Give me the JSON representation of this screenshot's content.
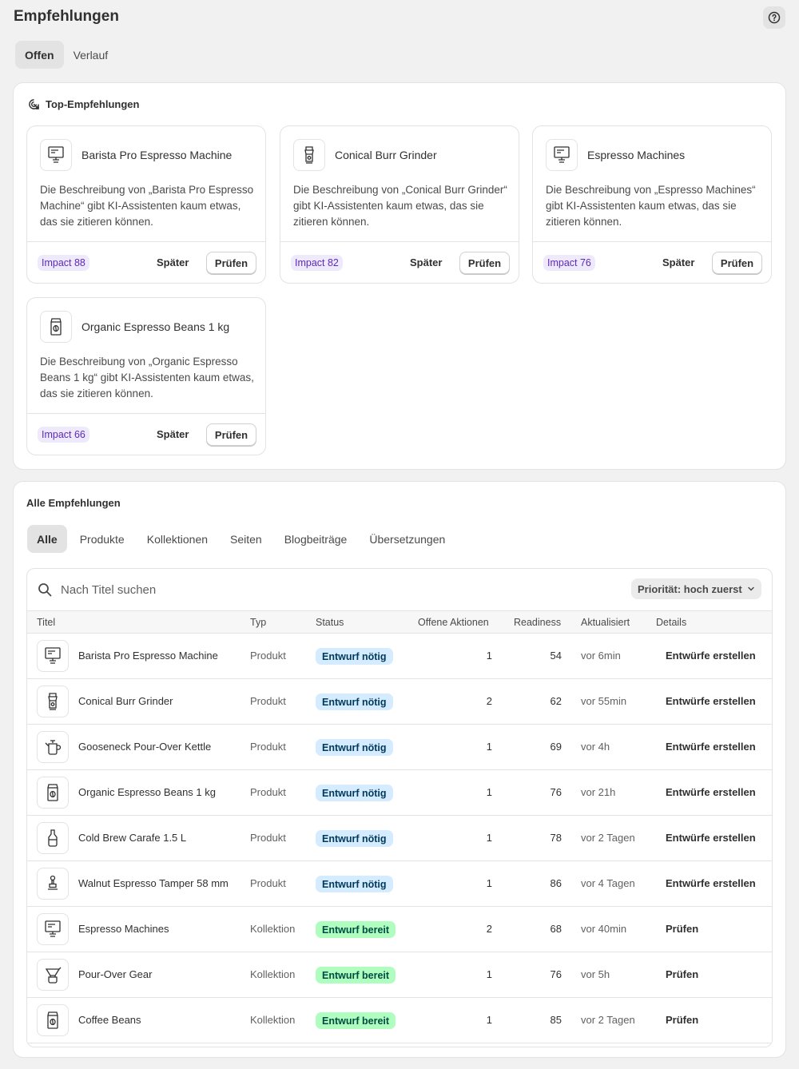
{
  "page": {
    "title": "Empfehlungen"
  },
  "top_tabs": [
    {
      "label": "Offen",
      "active": true
    },
    {
      "label": "Verlauf",
      "active": false
    }
  ],
  "top_section": {
    "title": "Top-Empfehlungen",
    "later_label": "Später",
    "review_label": "Prüfen",
    "cards": [
      {
        "name": "Barista Pro Espresso Machine",
        "icon": "espresso-machine-icon",
        "description": "Die Beschreibung von „Barista Pro Espresso Machine“ gibt KI-Assistenten kaum etwas, das sie zitieren können.",
        "impact": "Impact 88"
      },
      {
        "name": "Conical Burr Grinder",
        "icon": "grinder-icon",
        "description": "Die Beschreibung von „Conical Burr Grinder“ gibt KI-Assistenten kaum etwas, das sie zitieren können.",
        "impact": "Impact 82"
      },
      {
        "name": "Espresso Machines",
        "icon": "espresso-machine-icon",
        "description": "Die Beschreibung von „Espresso Machines“ gibt KI-Assistenten kaum etwas, das sie zitieren können.",
        "impact": "Impact 76"
      },
      {
        "name": "Organic Espresso Beans 1 kg",
        "icon": "coffee-bag-icon",
        "description": "Die Beschreibung von „Organic Espresso Beans 1 kg“ gibt KI-Assistenten kaum etwas, das sie zitieren können.",
        "impact": "Impact 66"
      }
    ]
  },
  "all_section": {
    "title": "Alle Empfehlungen",
    "filter_tabs": [
      {
        "label": "Alle",
        "active": true
      },
      {
        "label": "Produkte",
        "active": false
      },
      {
        "label": "Kollektionen",
        "active": false
      },
      {
        "label": "Seiten",
        "active": false
      },
      {
        "label": "Blogbeiträge",
        "active": false
      },
      {
        "label": "Übersetzungen",
        "active": false
      }
    ],
    "search": {
      "placeholder": "Nach Titel suchen",
      "value": ""
    },
    "sort_label": "Priorität: hoch zuerst",
    "columns": [
      "Titel",
      "Typ",
      "Status",
      "Offene Aktionen",
      "Readiness",
      "Aktualisiert",
      "Details"
    ],
    "rows": [
      {
        "title": "Barista Pro Espresso Machine",
        "icon": "espresso-machine-icon",
        "type": "Produkt",
        "status": "Entwurf nötig",
        "status_kind": "need",
        "open_actions": "1",
        "readiness": "54",
        "updated": "vor 6min",
        "action": "Entwürfe erstellen"
      },
      {
        "title": "Conical Burr Grinder",
        "icon": "grinder-icon",
        "type": "Produkt",
        "status": "Entwurf nötig",
        "status_kind": "need",
        "open_actions": "2",
        "readiness": "62",
        "updated": "vor 55min",
        "action": "Entwürfe erstellen"
      },
      {
        "title": "Gooseneck Pour-Over Kettle",
        "icon": "kettle-icon",
        "type": "Produkt",
        "status": "Entwurf nötig",
        "status_kind": "need",
        "open_actions": "1",
        "readiness": "69",
        "updated": "vor 4h",
        "action": "Entwürfe erstellen"
      },
      {
        "title": "Organic Espresso Beans 1 kg",
        "icon": "coffee-bag-icon",
        "type": "Produkt",
        "status": "Entwurf nötig",
        "status_kind": "need",
        "open_actions": "1",
        "readiness": "76",
        "updated": "vor 21h",
        "action": "Entwürfe erstellen"
      },
      {
        "title": "Cold Brew Carafe 1.5 L",
        "icon": "carafe-icon",
        "type": "Produkt",
        "status": "Entwurf nötig",
        "status_kind": "need",
        "open_actions": "1",
        "readiness": "78",
        "updated": "vor 2 Tagen",
        "action": "Entwürfe erstellen"
      },
      {
        "title": "Walnut Espresso Tamper 58 mm",
        "icon": "tamper-icon",
        "type": "Produkt",
        "status": "Entwurf nötig",
        "status_kind": "need",
        "open_actions": "1",
        "readiness": "86",
        "updated": "vor 4 Tagen",
        "action": "Entwürfe erstellen"
      },
      {
        "title": "Espresso Machines",
        "icon": "espresso-machine-icon",
        "type": "Kollektion",
        "status": "Entwurf bereit",
        "status_kind": "ready",
        "open_actions": "2",
        "readiness": "68",
        "updated": "vor 40min",
        "action": "Prüfen"
      },
      {
        "title": "Pour-Over Gear",
        "icon": "pour-over-icon",
        "type": "Kollektion",
        "status": "Entwurf bereit",
        "status_kind": "ready",
        "open_actions": "1",
        "readiness": "76",
        "updated": "vor 5h",
        "action": "Prüfen"
      },
      {
        "title": "Coffee Beans",
        "icon": "coffee-bag-icon",
        "type": "Kollektion",
        "status": "Entwurf bereit",
        "status_kind": "ready",
        "open_actions": "1",
        "readiness": "85",
        "updated": "vor 2 Tagen",
        "action": "Prüfen"
      }
    ]
  },
  "colors": {
    "impact_bg": "#efe9fc",
    "impact_text": "#5c2bb8",
    "need_bg": "#d5ebff",
    "ready_bg": "#affebf"
  }
}
